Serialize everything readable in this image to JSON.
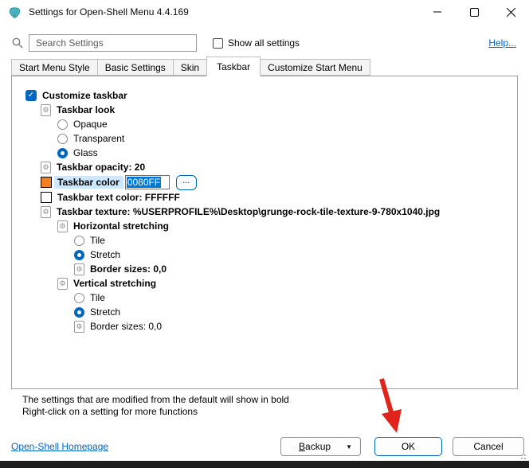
{
  "window": {
    "title": "Settings for Open-Shell Menu 4.4.169"
  },
  "toolbar": {
    "search_placeholder": "Search Settings",
    "show_all_label": "Show all settings",
    "help_label": "Help..."
  },
  "tabs": {
    "active": "Taskbar",
    "items": [
      {
        "label": "Start Menu Style"
      },
      {
        "label": "Basic Settings"
      },
      {
        "label": "Skin"
      },
      {
        "label": "Taskbar"
      },
      {
        "label": "Customize Start Menu"
      }
    ]
  },
  "tree": {
    "items": [
      {
        "label": "Customize taskbar",
        "control": "checkbox",
        "checked": true,
        "bold": true
      },
      {
        "label": "Taskbar look",
        "control": "setting-icon",
        "bold": true
      },
      {
        "label": "Opaque",
        "control": "radio",
        "selected": false,
        "bold": false
      },
      {
        "label": "Transparent",
        "control": "radio",
        "selected": false,
        "bold": false
      },
      {
        "label": "Glass",
        "control": "radio",
        "selected": true,
        "bold": false
      },
      {
        "label": "Taskbar opacity: 20",
        "control": "setting-icon",
        "bold": true
      },
      {
        "label": "Taskbar color",
        "control": "color-swatch",
        "swatch_color": "#F28022",
        "value": "0080FF",
        "browse_label": "...",
        "bold": true,
        "selected": true
      },
      {
        "label": "Taskbar text color: FFFFFF",
        "control": "color-swatch",
        "swatch_color": "#FFFFFF",
        "bold": true
      },
      {
        "label": "Taskbar texture: %USERPROFILE%\\Desktop\\grunge-rock-tile-texture-9-780x1040.jpg",
        "control": "setting-icon",
        "bold": true
      },
      {
        "label": "Horizontal stretching",
        "control": "setting-icon",
        "bold": true
      },
      {
        "label": "Tile",
        "control": "radio",
        "selected": false,
        "bold": false
      },
      {
        "label": "Stretch",
        "control": "radio",
        "selected": true,
        "bold": false
      },
      {
        "label": "Border sizes: 0,0",
        "control": "setting-icon",
        "bold": true
      },
      {
        "label": "Vertical stretching",
        "control": "setting-icon",
        "bold": true
      },
      {
        "label": "Tile",
        "control": "radio",
        "selected": false,
        "bold": false
      },
      {
        "label": "Stretch",
        "control": "radio",
        "selected": true,
        "bold": false
      },
      {
        "label": "Border sizes: 0,0",
        "control": "setting-icon",
        "bold": false
      }
    ]
  },
  "notes": {
    "line1": "The settings that are modified from the default will show in bold",
    "line2": "Right-click on a setting for more functions"
  },
  "footer": {
    "homepage_label": "Open-Shell Homepage",
    "backup_label": "Backup",
    "ok_label": "OK",
    "cancel_label": "Cancel"
  },
  "colors": {
    "accent": "#0067C0",
    "selection_bg": "#CCE8FF",
    "text_selection_bg": "#0078D7",
    "swatch_orange": "#F28022",
    "swatch_white": "#FFFFFF",
    "link": "#0066CC",
    "arrow_red": "#E0241B"
  }
}
